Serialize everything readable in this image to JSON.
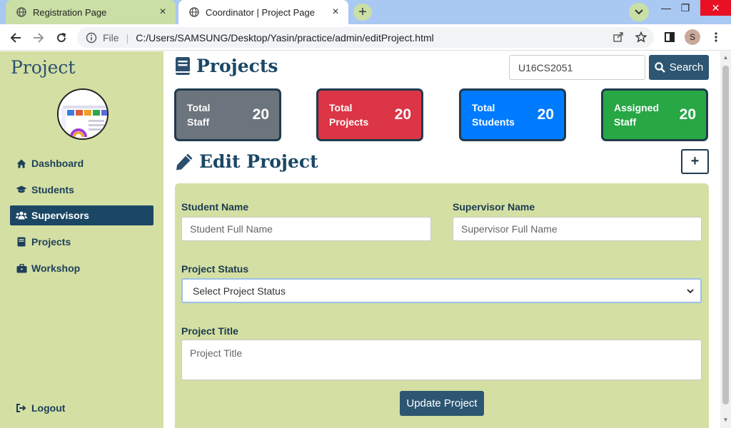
{
  "browser": {
    "tabs": [
      {
        "title": "Registration Page",
        "active": false
      },
      {
        "title": "Coordinator | Project Page",
        "active": true
      }
    ],
    "address": {
      "scheme": "File",
      "url": "C:/Users/SAMSUNG/Desktop/Yasin/practice/admin/editProject.html"
    },
    "profile_initial": "S",
    "window_controls": {
      "minimize": "—",
      "restore": "❐",
      "close": "✕"
    }
  },
  "sidebar": {
    "brand": "Project",
    "items": [
      {
        "label": "Dashboard",
        "icon": "home-icon",
        "active": false
      },
      {
        "label": "Students",
        "icon": "graduation-cap-icon",
        "active": false
      },
      {
        "label": "Supervisors",
        "icon": "users-icon",
        "active": true
      },
      {
        "label": "Projects",
        "icon": "book-icon",
        "active": false
      },
      {
        "label": "Workshop",
        "icon": "briefcase-icon",
        "active": false
      }
    ],
    "logout_label": "Logout"
  },
  "header": {
    "title": "Projects",
    "search": {
      "value": "U16CS2051",
      "button_label": "Search"
    }
  },
  "stats": [
    {
      "label_line1": "Total",
      "label_line2": "Staff",
      "value": "20",
      "color": "#6c757d"
    },
    {
      "label_line1": "Total",
      "label_line2": "Projects",
      "value": "20",
      "color": "#dc3545"
    },
    {
      "label_line1": "Total",
      "label_line2": "Students",
      "value": "20",
      "color": "#007bff"
    },
    {
      "label_line1": "Assigned",
      "label_line2": "Staff",
      "value": "20",
      "color": "#28a745"
    }
  ],
  "form": {
    "title": "Edit Project",
    "add_button": "+",
    "student_name_label": "Student Name",
    "student_name_placeholder": "Student Full Name",
    "supervisor_name_label": "Supervisor Name",
    "supervisor_name_placeholder": "Supervisor Full Name",
    "status_label": "Project Status",
    "status_selected": "Select Project Status",
    "title_label": "Project Title",
    "title_placeholder": "Project Title",
    "submit_label": "Update Project"
  },
  "colors": {
    "sidebar_bg": "#d4dfa3",
    "primary_dark": "#1b4765",
    "button_bg": "#2c5672"
  }
}
